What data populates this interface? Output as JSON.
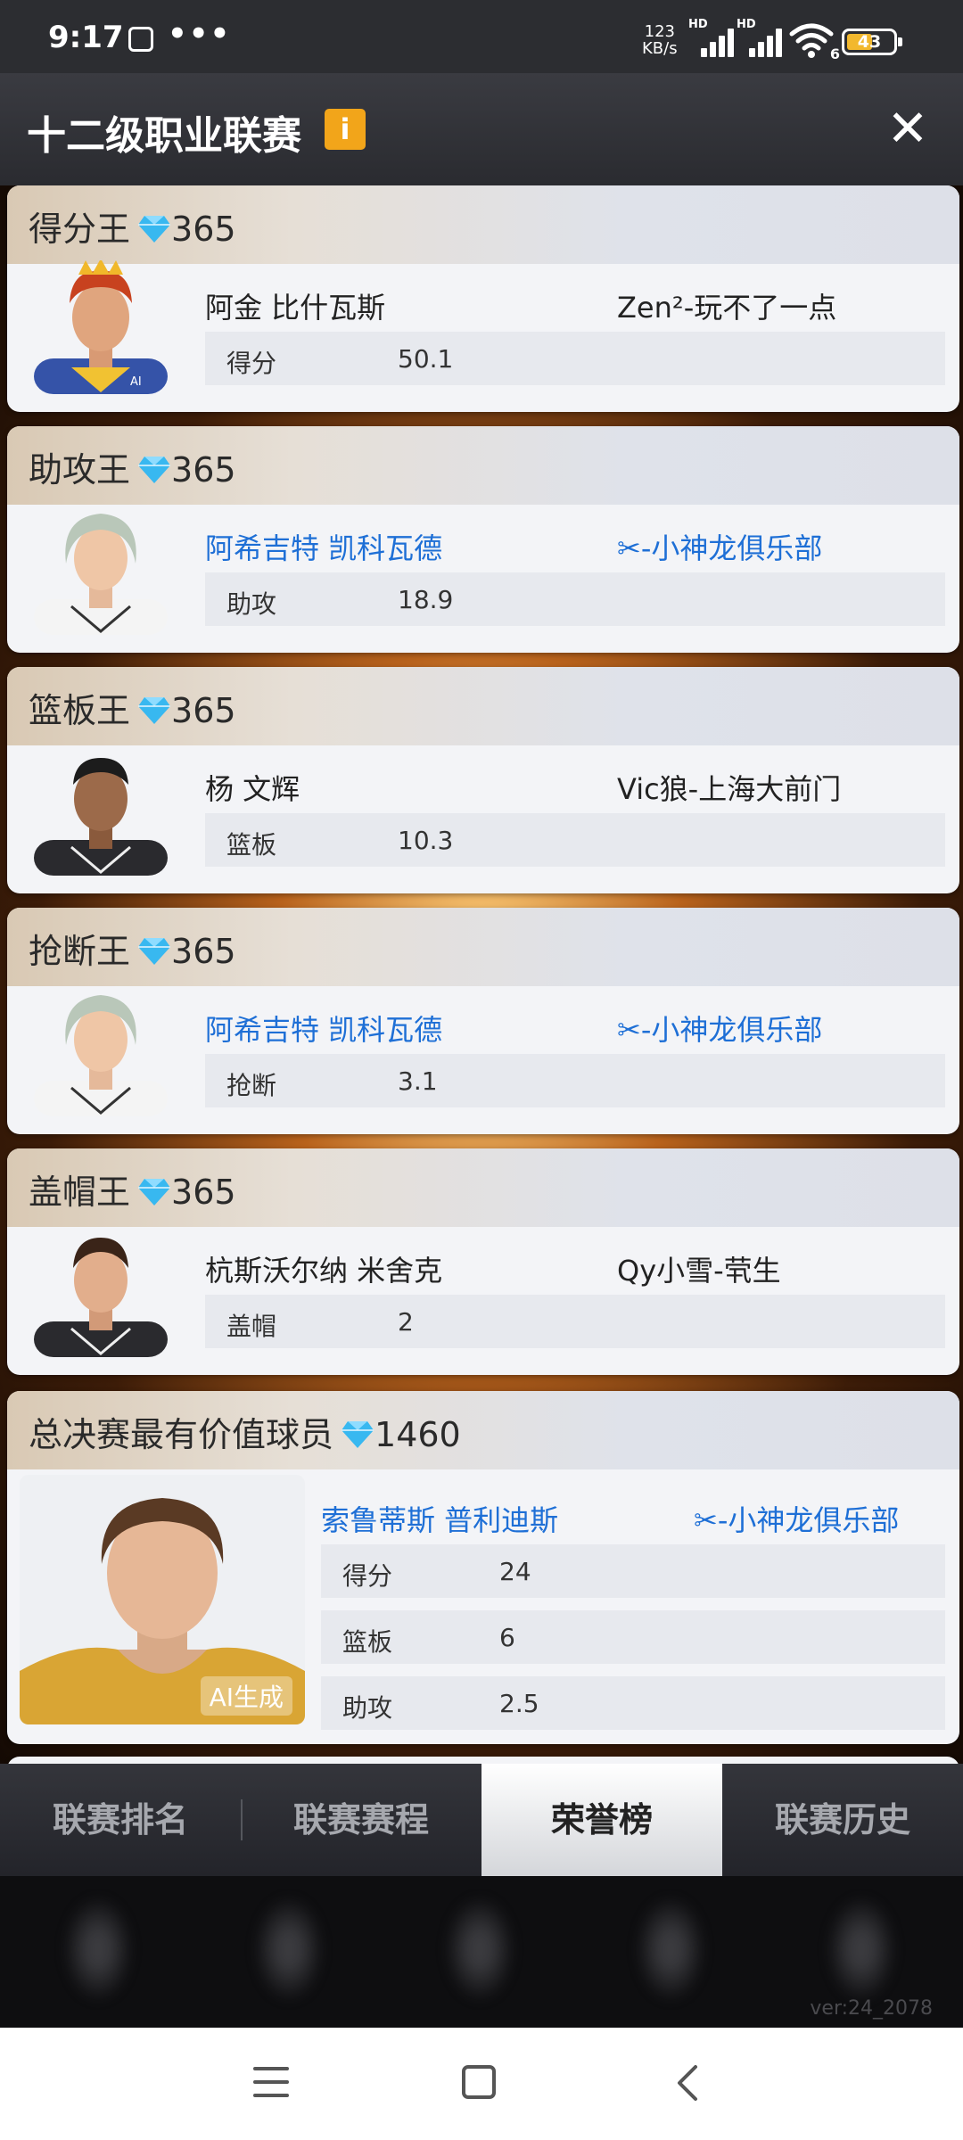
{
  "status_bar": {
    "time": "9:17",
    "dots": "•••",
    "speed_value": "123",
    "speed_unit": "KB/s",
    "hd": "HD",
    "wifi_badge": "6",
    "battery": "43"
  },
  "header": {
    "title": "十二级职业联赛",
    "info_icon": "i",
    "close_icon": "✕"
  },
  "awards": [
    {
      "title": "得分王",
      "diamonds": "365",
      "player": "阿金 比什瓦斯",
      "team": "Zen²-玩不了一点",
      "stat_label": "得分",
      "stat_value": "50.1"
    },
    {
      "title": "助攻王",
      "diamonds": "365",
      "player": "阿希吉特 凯科瓦德",
      "team": "-小神龙俱乐部",
      "stat_label": "助攻",
      "stat_value": "18.9"
    },
    {
      "title": "篮板王",
      "diamonds": "365",
      "player": "杨 文辉",
      "team": "Vic狼-上海大前门",
      "stat_label": "篮板",
      "stat_value": "10.3"
    },
    {
      "title": "抢断王",
      "diamonds": "365",
      "player": "阿希吉特 凯科瓦德",
      "team": "-小神龙俱乐部",
      "stat_label": "抢断",
      "stat_value": "3.1"
    },
    {
      "title": "盖帽王",
      "diamonds": "365",
      "player": "杭斯沃尔纳 米舍克",
      "team": "Qy小雪-茕生",
      "stat_label": "盖帽",
      "stat_value": "2"
    }
  ],
  "mvp": {
    "title": "总决赛最有价值球员",
    "diamonds": "1460",
    "player": "索鲁蒂斯 普利迪斯",
    "team": "-小神龙俱乐部",
    "ai_tag": "AI生成",
    "stats": [
      {
        "label": "得分",
        "value": "24"
      },
      {
        "label": "篮板",
        "value": "6"
      },
      {
        "label": "助攻",
        "value": "2.5"
      }
    ]
  },
  "tabs": [
    "联赛排名",
    "联赛赛程",
    "荣誉榜",
    "联赛历史"
  ],
  "active_tab": "荣誉榜",
  "version": "ver:24_2078",
  "colors": {
    "link_blue": "#1e6fd6",
    "gem": "#38b8f0",
    "info_badge": "#f2a51a"
  }
}
